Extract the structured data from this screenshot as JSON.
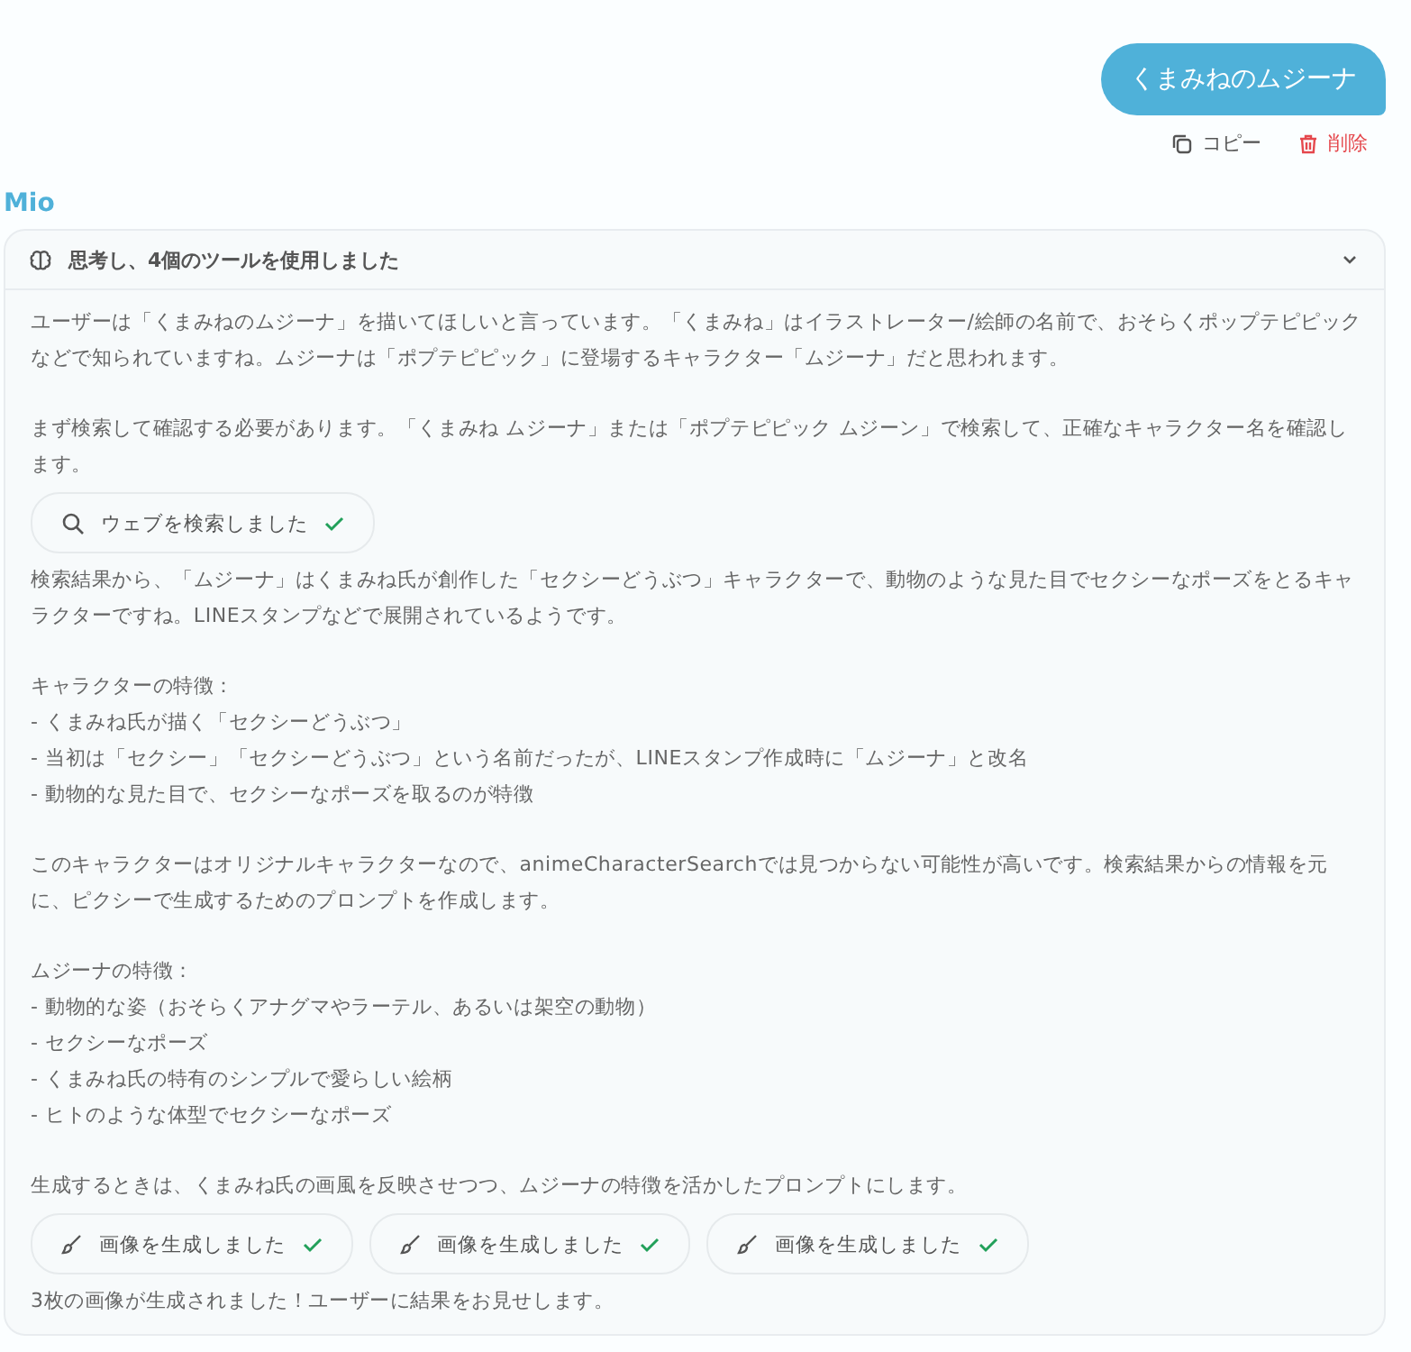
{
  "user_message": {
    "text": "くまみねのムジーナ",
    "actions": [
      {
        "kind": "copy",
        "label": "コピー"
      },
      {
        "kind": "delete",
        "label": "削除"
      }
    ]
  },
  "assistant": {
    "name": "Mio",
    "thinking": {
      "title": "思考し、4個のツールを使用しました",
      "expanded": true,
      "blocks": [
        {
          "kind": "lines",
          "lines": [
            "ユーザーは「くまみねのムジーナ」を描いてほしいと言っています。「くまみね」はイラストレーター/絵師の名前で、おそらくポップテピピックなどで知られていますね。ムジーナは「ポプテピピック」に登場するキャラクター「ムジーナ」だと思われます。"
          ]
        },
        {
          "kind": "lines",
          "lines": [
            "まず検索して確認する必要があります。「くまみね ムジーナ」または「ポプテピピック ムジーン」で検索して、正確なキャラクター名を確認します。"
          ]
        },
        {
          "kind": "tools",
          "tools": [
            {
              "kind": "search",
              "label": "ウェブを検索しました",
              "done": true
            }
          ]
        },
        {
          "kind": "lines",
          "lines": [
            "検索結果から、「ムジーナ」はくまみね氏が創作した「セクシーどうぶつ」キャラクターで、動物のような見た目でセクシーなポーズをとるキャラクターですね。LINEスタンプなどで展開されているようです。"
          ]
        },
        {
          "kind": "lines",
          "lines": [
            "キャラクターの特徴：",
            "- くまみね氏が描く「セクシーどうぶつ」",
            "- 当初は「セクシー」「セクシーどうぶつ」という名前だったが、LINEスタンプ作成時に「ムジーナ」と改名",
            "- 動物的な見た目で、セクシーなポーズを取るのが特徴"
          ]
        },
        {
          "kind": "lines",
          "lines": [
            "このキャラクターはオリジナルキャラクターなので、animeCharacterSearchでは見つからない可能性が高いです。検索結果からの情報を元に、ピクシーで生成するためのプロンプトを作成します。"
          ]
        },
        {
          "kind": "lines",
          "lines": [
            "ムジーナの特徴：",
            "- 動物的な姿（おそらくアナグマやラーテル、あるいは架空の動物）",
            "- セクシーなポーズ",
            "- くまみね氏の特有のシンプルで愛らしい絵柄",
            "- ヒトのような体型でセクシーなポーズ"
          ]
        },
        {
          "kind": "lines",
          "lines": [
            "生成するときは、くまみね氏の画風を反映させつつ、ムジーナの特徴を活かしたプロンプトにします。"
          ]
        },
        {
          "kind": "tools",
          "tools": [
            {
              "kind": "image",
              "label": "画像を生成しました",
              "done": true
            },
            {
              "kind": "image",
              "label": "画像を生成しました",
              "done": true
            },
            {
              "kind": "image",
              "label": "画像を生成しました",
              "done": true
            }
          ]
        },
        {
          "kind": "lines",
          "lines": [
            "3枚の画像が生成されました！ユーザーに結果をお見せします。"
          ]
        }
      ]
    }
  }
}
